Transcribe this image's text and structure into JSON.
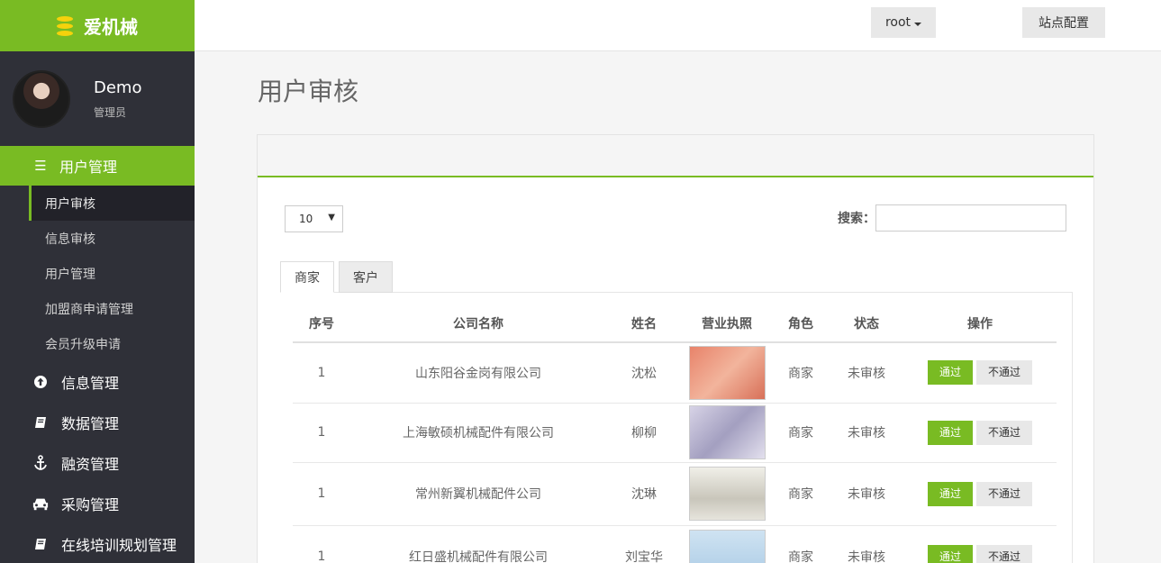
{
  "brand": {
    "name": "爱机械"
  },
  "profile": {
    "name": "Demo",
    "role": "管理员"
  },
  "sidebar": {
    "active_group": "用户管理",
    "sub_items": [
      "用户审核",
      "信息审核",
      "用户管理",
      "加盟商申请管理",
      "会员升级申请"
    ],
    "items": [
      {
        "label": "信息管理",
        "icon": "arrow-up-circle-icon"
      },
      {
        "label": "数据管理",
        "icon": "book-icon"
      },
      {
        "label": "融资管理",
        "icon": "anchor-icon"
      },
      {
        "label": "采购管理",
        "icon": "car-icon"
      },
      {
        "label": "在线培训规划管理",
        "icon": "book-icon"
      }
    ]
  },
  "header": {
    "user_button": "root",
    "site_button": "站点配置"
  },
  "page": {
    "title": "用户审核"
  },
  "controls": {
    "page_length": "10",
    "search_label": "搜索："
  },
  "tabs": [
    "商家",
    "客户"
  ],
  "table": {
    "headers": [
      "序号",
      "公司名称",
      "姓名",
      "营业执照",
      "角色",
      "状态",
      "操作"
    ],
    "pass_label": "通过",
    "fail_label": "不通过",
    "rows": [
      {
        "no": "1",
        "company": "山东阳谷金岗有限公司",
        "name": "沈松",
        "role": "商家",
        "status": "未审核"
      },
      {
        "no": "1",
        "company": "上海敏硕机械配件有限公司",
        "name": "柳柳",
        "role": "商家",
        "status": "未审核"
      },
      {
        "no": "1",
        "company": "常州新翼机械配件公司",
        "name": "沈琳",
        "role": "商家",
        "status": "未审核"
      },
      {
        "no": "1",
        "company": "红日盛机械配件有限公司",
        "name": "刘宝华",
        "role": "商家",
        "status": "未审核"
      }
    ]
  },
  "colors": {
    "accent": "#79bb23",
    "sidebar_bg": "#2f3038"
  }
}
